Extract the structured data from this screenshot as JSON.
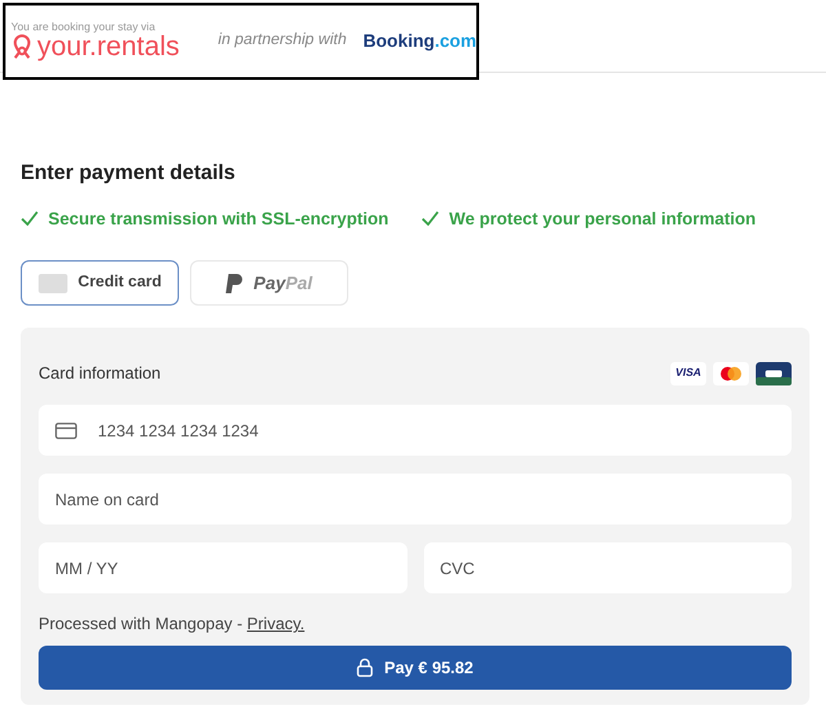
{
  "header": {
    "tagline": "You are booking your stay via",
    "brand": "your.rentals",
    "partner_text": "in partnership with",
    "partner_brand": "Booking",
    "partner_suffix": ".com"
  },
  "title": "Enter payment details",
  "assurances": [
    "Secure transmission with SSL-encryption",
    "We protect your personal information"
  ],
  "payment_methods": [
    {
      "kind": "card",
      "label": "Credit card",
      "selected": true
    },
    {
      "kind": "paypal",
      "label": "Pay",
      "label_suffix": "Pal",
      "selected": false
    }
  ],
  "card_form": {
    "heading": "Card information",
    "card_brands": [
      {
        "kind": "visa",
        "label": "VISA"
      },
      {
        "kind": "mastercard"
      },
      {
        "kind": "cb"
      }
    ],
    "card_number": {
      "placeholder": "1234 1234 1234 1234"
    },
    "name": {
      "placeholder": "Name on card"
    },
    "expiry": {
      "placeholder": "MM / YY"
    },
    "cvc": {
      "placeholder": "CVC"
    },
    "processor_text": "Processed with Mangopay - ",
    "privacy_link": "Privacy.",
    "pay_button": "Pay € 95.82"
  }
}
